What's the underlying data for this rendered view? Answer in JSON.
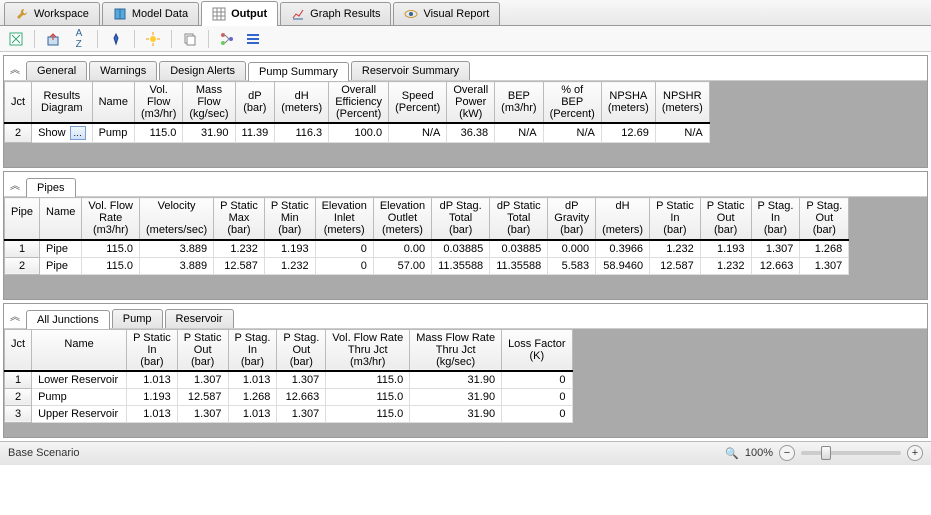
{
  "mainTabs": [
    {
      "label": "Workspace",
      "icon": "wrench"
    },
    {
      "label": "Model Data",
      "icon": "book"
    },
    {
      "label": "Output",
      "icon": "grid",
      "active": true
    },
    {
      "label": "Graph Results",
      "icon": "chart"
    },
    {
      "label": "Visual Report",
      "icon": "eye"
    }
  ],
  "panel1": {
    "subTabs": [
      "General",
      "Warnings",
      "Design Alerts",
      "Pump Summary",
      "Reservoir Summary"
    ],
    "activeSubTab": "Pump Summary",
    "columns": [
      {
        "h1": "Jct",
        "h2": ""
      },
      {
        "h1": "Results",
        "h2": "Diagram"
      },
      {
        "h1": "Name",
        "h2": ""
      },
      {
        "h1": "Vol.",
        "h2": "Flow",
        "h3": "(m3/hr)"
      },
      {
        "h1": "Mass",
        "h2": "Flow",
        "h3": "(kg/sec)"
      },
      {
        "h1": "dP",
        "h2": "",
        "h3": "(bar)"
      },
      {
        "h1": "dH",
        "h2": "",
        "h3": "(meters)"
      },
      {
        "h1": "Overall",
        "h2": "Efficiency",
        "h3": "(Percent)"
      },
      {
        "h1": "Speed",
        "h2": "",
        "h3": "(Percent)"
      },
      {
        "h1": "Overall",
        "h2": "Power",
        "h3": "(kW)"
      },
      {
        "h1": "BEP",
        "h2": "",
        "h3": "(m3/hr)"
      },
      {
        "h1": "% of",
        "h2": "BEP",
        "h3": "(Percent)"
      },
      {
        "h1": "NPSHA",
        "h2": "",
        "h3": "(meters)"
      },
      {
        "h1": "NPSHR",
        "h2": "",
        "h3": "(meters)"
      }
    ],
    "rows": [
      {
        "jct": "2",
        "show": "Show",
        "name": "Pump",
        "vals": [
          "115.0",
          "31.90",
          "11.39",
          "116.3",
          "100.0",
          "N/A",
          "36.38",
          "N/A",
          "N/A",
          "12.69",
          "N/A"
        ]
      }
    ]
  },
  "panel2": {
    "subTabs": [
      "Pipes"
    ],
    "activeSubTab": "Pipes",
    "columns": [
      {
        "h1": "Pipe"
      },
      {
        "h1": "Name"
      },
      {
        "h1": "Vol. Flow",
        "h2": "Rate",
        "h3": "(m3/hr)"
      },
      {
        "h1": "Velocity",
        "h3": "(meters/sec)"
      },
      {
        "h1": "P Static",
        "h2": "Max",
        "h3": "(bar)"
      },
      {
        "h1": "P Static",
        "h2": "Min",
        "h3": "(bar)"
      },
      {
        "h1": "Elevation",
        "h2": "Inlet",
        "h3": "(meters)"
      },
      {
        "h1": "Elevation",
        "h2": "Outlet",
        "h3": "(meters)"
      },
      {
        "h1": "dP Stag.",
        "h2": "Total",
        "h3": "(bar)"
      },
      {
        "h1": "dP Static",
        "h2": "Total",
        "h3": "(bar)"
      },
      {
        "h1": "dP",
        "h2": "Gravity",
        "h3": "(bar)"
      },
      {
        "h1": "dH",
        "h3": "(meters)"
      },
      {
        "h1": "P Static",
        "h2": "In",
        "h3": "(bar)"
      },
      {
        "h1": "P Static",
        "h2": "Out",
        "h3": "(bar)"
      },
      {
        "h1": "P Stag.",
        "h2": "In",
        "h3": "(bar)"
      },
      {
        "h1": "P Stag.",
        "h2": "Out",
        "h3": "(bar)"
      }
    ],
    "rows": [
      {
        "id": "1",
        "name": "Pipe",
        "vals": [
          "115.0",
          "3.889",
          "1.232",
          "1.193",
          "0",
          "0.00",
          "0.03885",
          "0.03885",
          "0.000",
          "0.3966",
          "1.232",
          "1.193",
          "1.307",
          "1.268"
        ]
      },
      {
        "id": "2",
        "name": "Pipe",
        "vals": [
          "115.0",
          "3.889",
          "12.587",
          "1.232",
          "0",
          "57.00",
          "11.35588",
          "11.35588",
          "5.583",
          "58.9460",
          "12.587",
          "1.232",
          "12.663",
          "1.307"
        ]
      }
    ]
  },
  "panel3": {
    "subTabs": [
      "All Junctions",
      "Pump",
      "Reservoir"
    ],
    "activeSubTab": "All Junctions",
    "columns": [
      {
        "h1": "Jct"
      },
      {
        "h1": "Name"
      },
      {
        "h1": "P Static",
        "h2": "In",
        "h3": "(bar)"
      },
      {
        "h1": "P Static",
        "h2": "Out",
        "h3": "(bar)"
      },
      {
        "h1": "P Stag.",
        "h2": "In",
        "h3": "(bar)"
      },
      {
        "h1": "P Stag.",
        "h2": "Out",
        "h3": "(bar)"
      },
      {
        "h1": "Vol. Flow Rate",
        "h2": "Thru Jct",
        "h3": "(m3/hr)"
      },
      {
        "h1": "Mass Flow Rate",
        "h2": "Thru Jct",
        "h3": "(kg/sec)"
      },
      {
        "h1": "Loss Factor",
        "h2": "(K)"
      }
    ],
    "rows": [
      {
        "id": "1",
        "name": "Lower Reservoir",
        "vals": [
          "1.013",
          "1.307",
          "1.013",
          "1.307",
          "115.0",
          "31.90",
          "0"
        ]
      },
      {
        "id": "2",
        "name": "Pump",
        "vals": [
          "1.193",
          "12.587",
          "1.268",
          "12.663",
          "115.0",
          "31.90",
          "0"
        ]
      },
      {
        "id": "3",
        "name": "Upper Reservoir",
        "vals": [
          "1.013",
          "1.307",
          "1.013",
          "1.307",
          "115.0",
          "31.90",
          "0"
        ]
      }
    ]
  },
  "statusBar": {
    "scenario": "Base Scenario",
    "zoom": "100%"
  }
}
